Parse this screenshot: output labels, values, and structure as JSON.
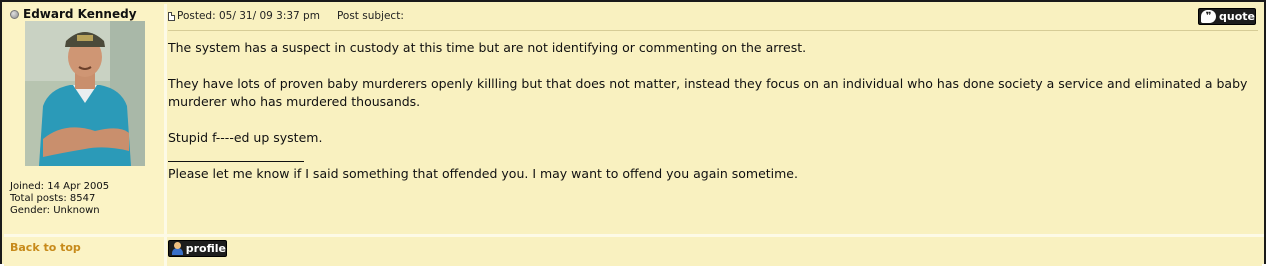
{
  "user": {
    "name": "Edward Kennedy",
    "joined": "Joined: 14 Apr 2005",
    "total_posts": "Total posts: 8547",
    "gender": "Gender: Unknown"
  },
  "post": {
    "posted": "Posted: 05/ 31/ 09 3:37 pm",
    "subject_label": "Post subject:",
    "paragraphs": [
      "The system has a suspect in custody at this time but are not identifying or commenting on the arrest.",
      "They have lots of proven baby murderers openly killling but that does not matter, instead they focus on an individual who has done society a service and eliminated a baby murderer who has murdered thousands.",
      "Stupid f----ed up system."
    ],
    "signature": "Please let me know if I said something that offended you. I may want to offend you again sometime."
  },
  "buttons": {
    "quote_label": "quote",
    "profile_label": "profile",
    "back_to_top": "Back to top"
  },
  "icons": {
    "status": "offline-status-icon",
    "post": "post-icon",
    "quote": "quote-icon",
    "profile": "profile-icon"
  },
  "colors": {
    "panel_bg": "#f9f1c0",
    "border": "#1a1a1a",
    "link": "#c78a1a",
    "button_bg": "#1d1d1d"
  }
}
